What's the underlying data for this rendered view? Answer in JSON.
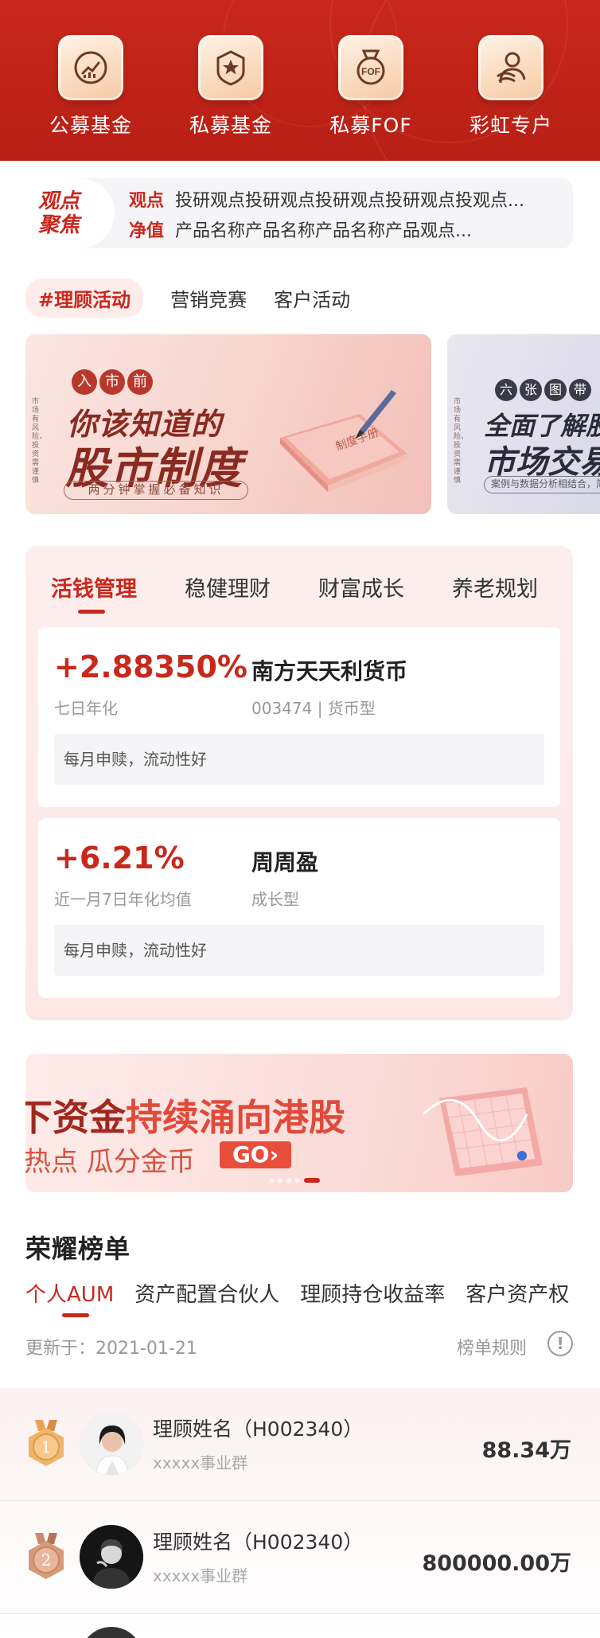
{
  "nav": [
    {
      "label": "公募基金",
      "icon": "chart-coin-icon"
    },
    {
      "label": "私募基金",
      "icon": "star-badge-icon"
    },
    {
      "label": "私募FOF",
      "icon": "fof-medal-icon"
    },
    {
      "label": "彩虹专户",
      "icon": "rainbow-user-icon"
    }
  ],
  "focus": {
    "logo_line1": "观点",
    "logo_line2": "聚焦",
    "rows": [
      {
        "tag": "观点",
        "text": "投研观点投研观点投研观点投研观点投观点..."
      },
      {
        "tag": "净值",
        "text": "产品名称产品名称产品名称产品观点..."
      }
    ]
  },
  "activity_tabs": [
    "#理顾活动",
    "营销竞赛",
    "客户活动"
  ],
  "banners": {
    "b1": {
      "side": "市场有风险，投资需谨慎",
      "small": [
        "入",
        "市",
        "前"
      ],
      "title1": "你该知道的",
      "title2": "股市制度",
      "sub": "两分钟掌握必备知识",
      "book_text": "制度手册"
    },
    "b2": {
      "side": "市场有风险，投资需谨慎",
      "small": [
        "六",
        "张",
        "图",
        "带"
      ],
      "title1": "全面了解股",
      "title2": "市场交易",
      "sub": "案例与数据分析相结合，简单"
    }
  },
  "products": {
    "tabs": [
      "活钱管理",
      "稳健理财",
      "财富成长",
      "养老规划"
    ],
    "cards": [
      {
        "rate": "+2.88350%",
        "rate_label": "七日年化",
        "name": "南方天天利货币",
        "meta": "003474  |  货币型",
        "tag": "每月申赎，流动性好"
      },
      {
        "rate": "+6.21%",
        "rate_label": "近一月7日年化均值",
        "name": "周周盈",
        "meta": "成长型",
        "tag": "每月申赎，流动性好"
      }
    ]
  },
  "promo": {
    "t1_dark": "下资金",
    "t1_red": "持续涌向港股",
    "t2": "热点 瓜分金币",
    "go": "GO›"
  },
  "ranking": {
    "title": "荣耀榜单",
    "tabs": [
      "个人AUM",
      "资产配置合伙人",
      "理顾持仓收益率",
      "客户资产权"
    ],
    "updated": "更新于：2021-01-21",
    "rules": "榜单规则",
    "help": "!",
    "rows": [
      {
        "rank": "1",
        "name": "理顾姓名（H002340）",
        "dept": "xxxxx事业群",
        "value": "88.34万"
      },
      {
        "rank": "2",
        "name": "理顾姓名（H002340）",
        "dept": "xxxxx事业群",
        "value": "800000.00万"
      }
    ]
  },
  "colors": {
    "brand_red": "#c9281c",
    "gold": "#e8a35a"
  }
}
